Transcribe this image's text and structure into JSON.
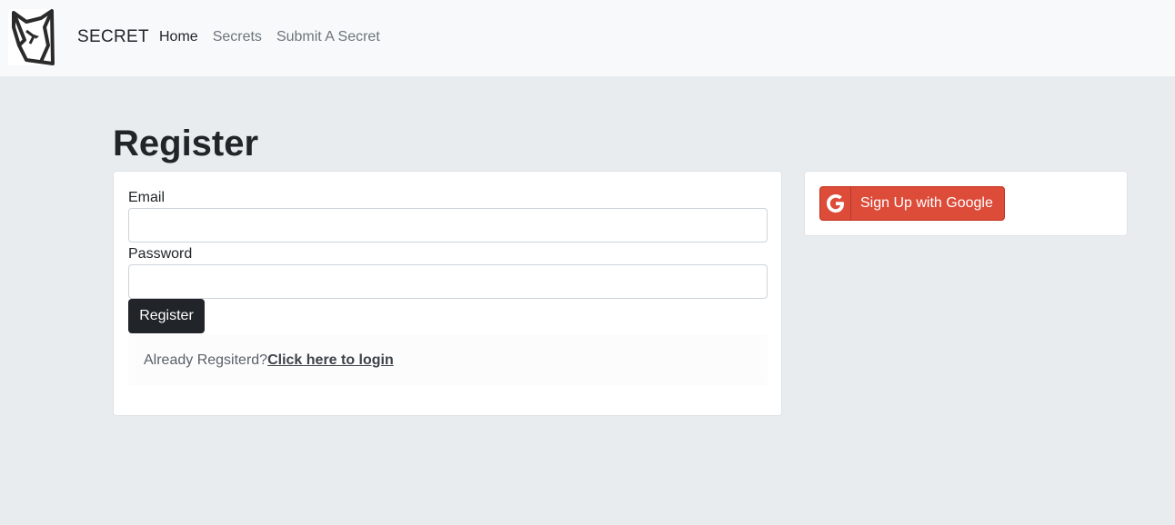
{
  "navbar": {
    "logo_icon": "fox-logo-icon",
    "brand": "SECRET",
    "links": [
      {
        "label": "Home",
        "active": true
      },
      {
        "label": "Secrets",
        "active": false
      },
      {
        "label": "Submit A Secret",
        "active": false
      }
    ]
  },
  "page": {
    "title": "Register"
  },
  "form": {
    "email_label": "Email",
    "email_value": "",
    "password_label": "Password",
    "password_value": "",
    "submit_label": "Register",
    "login_prompt": "Already Regsiterd?",
    "login_link": "Click here to login"
  },
  "social": {
    "google_icon": "google-g-icon",
    "google_label": "Sign Up with Google"
  },
  "colors": {
    "page_bg": "#e9ecef",
    "navbar_bg": "#f8f9fa",
    "primary_dark": "#212529",
    "google_red": "#dd4b39"
  }
}
